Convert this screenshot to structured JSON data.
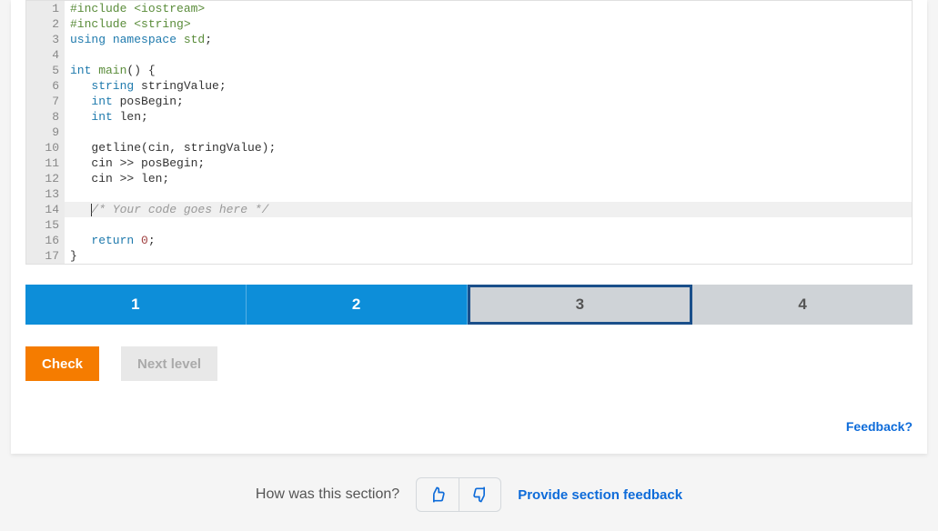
{
  "code": {
    "lines": [
      {
        "n": 1
      },
      {
        "n": 2
      },
      {
        "n": 3
      },
      {
        "n": 4
      },
      {
        "n": 5
      },
      {
        "n": 6
      },
      {
        "n": 7
      },
      {
        "n": 8
      },
      {
        "n": 9
      },
      {
        "n": 10
      },
      {
        "n": 11
      },
      {
        "n": 12
      },
      {
        "n": 13
      },
      {
        "n": 14,
        "active": true,
        "comment": "/* Your code goes here */"
      },
      {
        "n": 15
      },
      {
        "n": 16
      },
      {
        "n": 17
      }
    ],
    "tokens": {
      "include1_kw": "#include",
      "include1_hdr": " <iostream>",
      "include2_kw": "#include",
      "include2_hdr": " <string>",
      "using": "using",
      "namespace": " namespace",
      "std": " std",
      "semicolon": ";",
      "int": "int",
      "main": " main",
      "parens_brace": "() {",
      "string_t": "string",
      "stringValue_decl": " stringValue;",
      "int_t": "int",
      "posBegin_decl": " posBegin;",
      "len_decl": " len;",
      "getline_call": "getline(cin, stringValue);",
      "cin_pos": "cin >> posBegin;",
      "cin_len": "cin >> len;",
      "return_kw": "return",
      "zero": " 0",
      "close_brace": "}"
    }
  },
  "tabs": [
    {
      "label": "1",
      "state": "blue"
    },
    {
      "label": "2",
      "state": "blue"
    },
    {
      "label": "3",
      "state": "selected"
    },
    {
      "label": "4",
      "state": "gray"
    }
  ],
  "buttons": {
    "check": "Check",
    "next": "Next level"
  },
  "links": {
    "feedback_q": "Feedback?",
    "provide": "Provide section feedback"
  },
  "section_feedback_prompt": "How was this section?"
}
